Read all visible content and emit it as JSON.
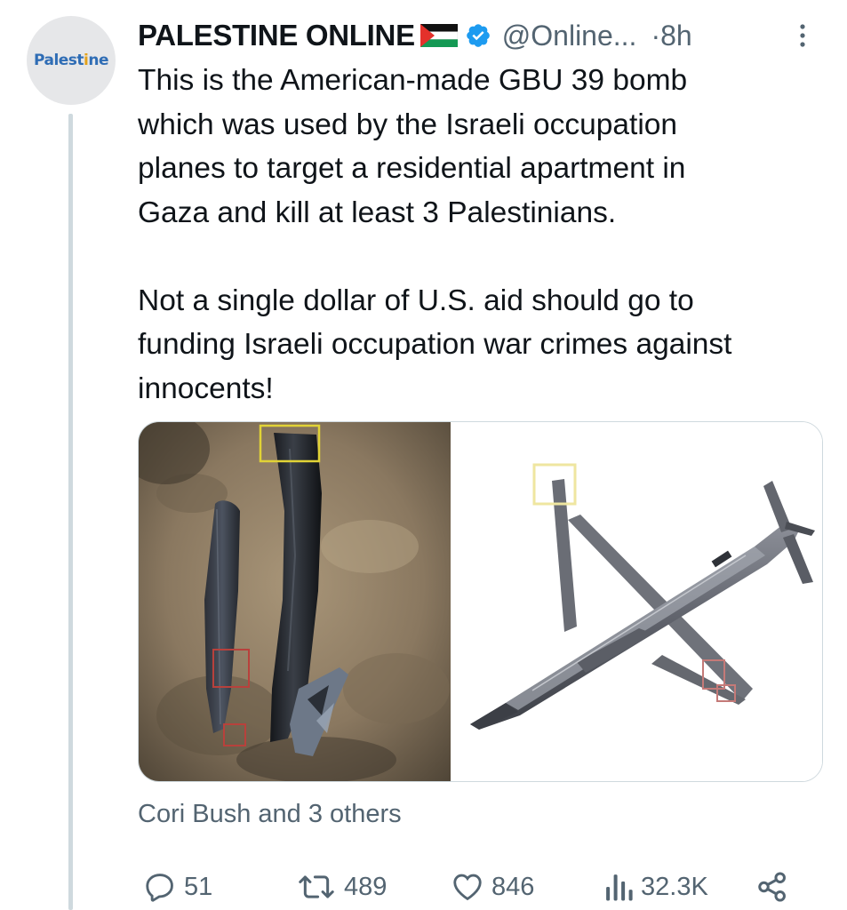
{
  "tweet": {
    "avatar": {
      "logo_text_main": "Palest",
      "logo_text_accent": "i",
      "logo_text_end": "ne"
    },
    "author": {
      "display_name": "PALESTINE ONLINE",
      "handle": "@Online...",
      "time": "·8h",
      "verified": true,
      "flag_icon": "palestine-flag-icon"
    },
    "text": "This is the American-made GBU 39 bomb\nwhich was used by the Israeli occupation\nplanes to target a residential apartment in\nGaza and kill at least 3 Palestinians.\n\nNot a single dollar of U.S. aid should go to\nfunding Israeli occupation war crimes against\ninnocents!",
    "media": {
      "images": [
        {
          "name": "bomb-fragments-photo"
        },
        {
          "name": "gbu39-render-image"
        }
      ]
    },
    "social_context": "Cori Bush and 3 others",
    "actions": {
      "replies": "51",
      "reposts": "489",
      "likes": "846",
      "views": "32.3K"
    }
  },
  "colors": {
    "text": "#0f1419",
    "secondary": "#536471",
    "verified": "#1d9bf0",
    "thread_line": "#cfd9de"
  }
}
